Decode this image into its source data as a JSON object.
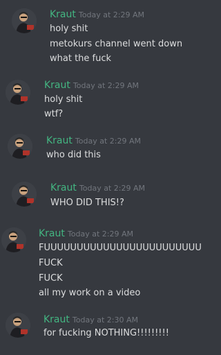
{
  "colors": {
    "background": "#36393f",
    "author": "#43b581",
    "timestamp": "#72767d",
    "text": "#dcddde"
  },
  "avatar_icon": "user-avatar-reading-book",
  "messages": [
    {
      "author": "Kraut",
      "timestamp": "Today at 2:29 AM",
      "lines": [
        "holy shit",
        "metokurs channel went down",
        "what the fuck"
      ]
    },
    {
      "author": "Kraut",
      "timestamp": "Today at 2:29 AM",
      "lines": [
        "holy shit",
        "wtf?"
      ]
    },
    {
      "author": "Kraut",
      "timestamp": "Today at 2:29 AM",
      "lines": [
        "who did this"
      ]
    },
    {
      "author": "Kraut",
      "timestamp": "Today at 2:29 AM",
      "lines": [
        "WHO DID THIS!?"
      ]
    },
    {
      "author": "Kraut",
      "timestamp": "Today at 2:29 AM",
      "lines": [
        "FUUUUUUUUUUUUUUUUUUUUUUUUUUUUUUUU",
        "FUCK",
        "FUCK",
        "all my work on a video"
      ]
    },
    {
      "author": "Kraut",
      "timestamp": "Today at 2:30 AM",
      "lines": [
        "for fucking NOTHING!!!!!!!!!"
      ]
    }
  ]
}
